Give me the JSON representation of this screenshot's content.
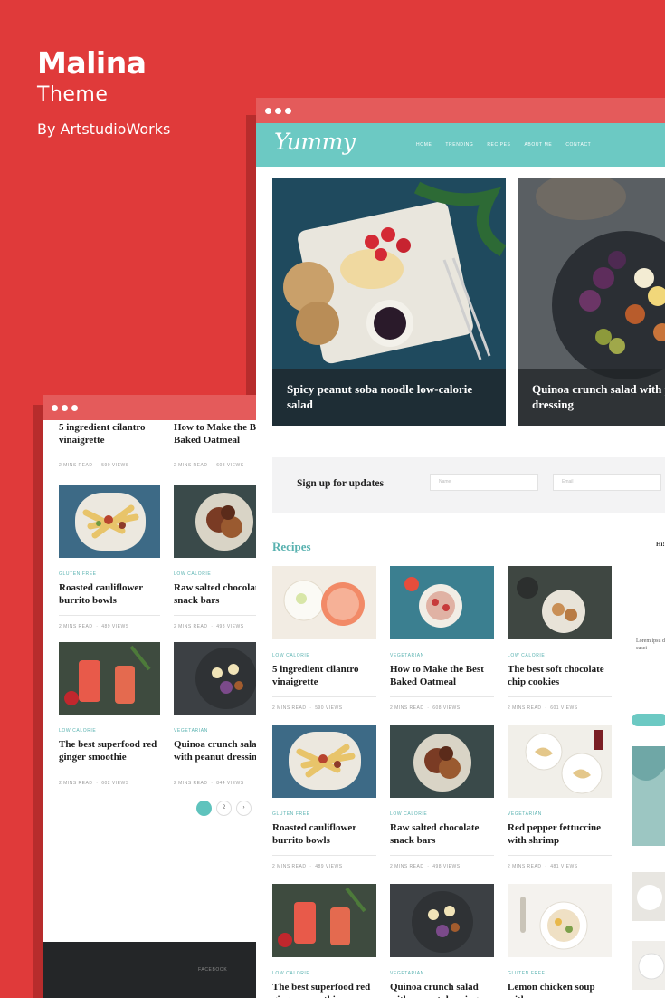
{
  "brand": {
    "title": "Malina",
    "subtitle": "Theme",
    "author": "By ArtstudioWorks"
  },
  "site": {
    "logo": "Yummy",
    "nav": [
      "HOME",
      "TRENDING",
      "RECIPES",
      "ABOUT ME",
      "CONTACT"
    ]
  },
  "hero": [
    {
      "title": "Spicy peanut soba noodle low-calorie salad"
    },
    {
      "title": "Quinoa crunch salad with peanut dressing"
    }
  ],
  "signup": {
    "title": "Sign up for updates",
    "name_placeholder": "Name",
    "email_placeholder": "Email"
  },
  "recipes_heading": "Recipes",
  "sidebar": {
    "greeting": "Hi!",
    "text": "Lorem ipsu dui, susci"
  },
  "back_cards": [
    {
      "category": "",
      "title": "5 ingredient cilantro vinaigrette",
      "read": "2 MINS READ",
      "views": "590 VIEWS"
    },
    {
      "category": "",
      "title": "How to Make the Best Baked Oatmeal",
      "read": "2 MINS READ",
      "views": "608 VIEWS"
    },
    {
      "category": "GLUTEN FREE",
      "title": "Roasted cauliflower burrito bowls",
      "read": "2 MINS READ",
      "views": "489 VIEWS"
    },
    {
      "category": "LOW CALORIE",
      "title": "Raw salted chocolate snack bars",
      "read": "2 MINS READ",
      "views": "498 VIEWS"
    },
    {
      "category": "LOW CALORIE",
      "title": "The best superfood red ginger smoothie",
      "read": "2 MINS READ",
      "views": "602 VIEWS"
    },
    {
      "category": "VEGETARIAN",
      "title": "Quinoa crunch salad with peanut dressing",
      "read": "2 MINS READ",
      "views": "844 VIEWS"
    }
  ],
  "pager": [
    "",
    "2",
    "›"
  ],
  "back_footer": "FACEBOOK",
  "cards": [
    {
      "category": "LOW CALORIE",
      "title": "5 ingredient cilantro vinaigrette",
      "read": "2 MINS READ",
      "views": "590 VIEWS"
    },
    {
      "category": "VEGETARIAN",
      "title": "How to Make the Best Baked Oatmeal",
      "read": "2 MINS READ",
      "views": "608 VIEWS"
    },
    {
      "category": "LOW CALORIE",
      "title": "The best soft chocolate chip cookies",
      "read": "2 MINS READ",
      "views": "601 VIEWS"
    },
    {
      "category": "GLUTEN FREE",
      "title": "Roasted cauliflower burrito bowls",
      "read": "2 MINS READ",
      "views": "489 VIEWS"
    },
    {
      "category": "LOW CALORIE",
      "title": "Raw salted chocolate snack bars",
      "read": "2 MINS READ",
      "views": "498 VIEWS"
    },
    {
      "category": "VEGETARIAN",
      "title": "Red pepper fettuccine with shrimp",
      "read": "2 MINS READ",
      "views": "481 VIEWS"
    },
    {
      "category": "LOW CALORIE",
      "title": "The best superfood red ginger smoothie",
      "read": "",
      "views": ""
    },
    {
      "category": "VEGETARIAN",
      "title": "Quinoa crunch salad with peanut dressing",
      "read": "",
      "views": ""
    },
    {
      "category": "GLUTEN FREE",
      "title": "Lemon chicken soup with orzo",
      "read": "",
      "views": ""
    }
  ],
  "colors": {
    "background": "#e03a3a",
    "header": "#6cc9c3",
    "accent": "#59b2b0",
    "footer": "#242628"
  }
}
